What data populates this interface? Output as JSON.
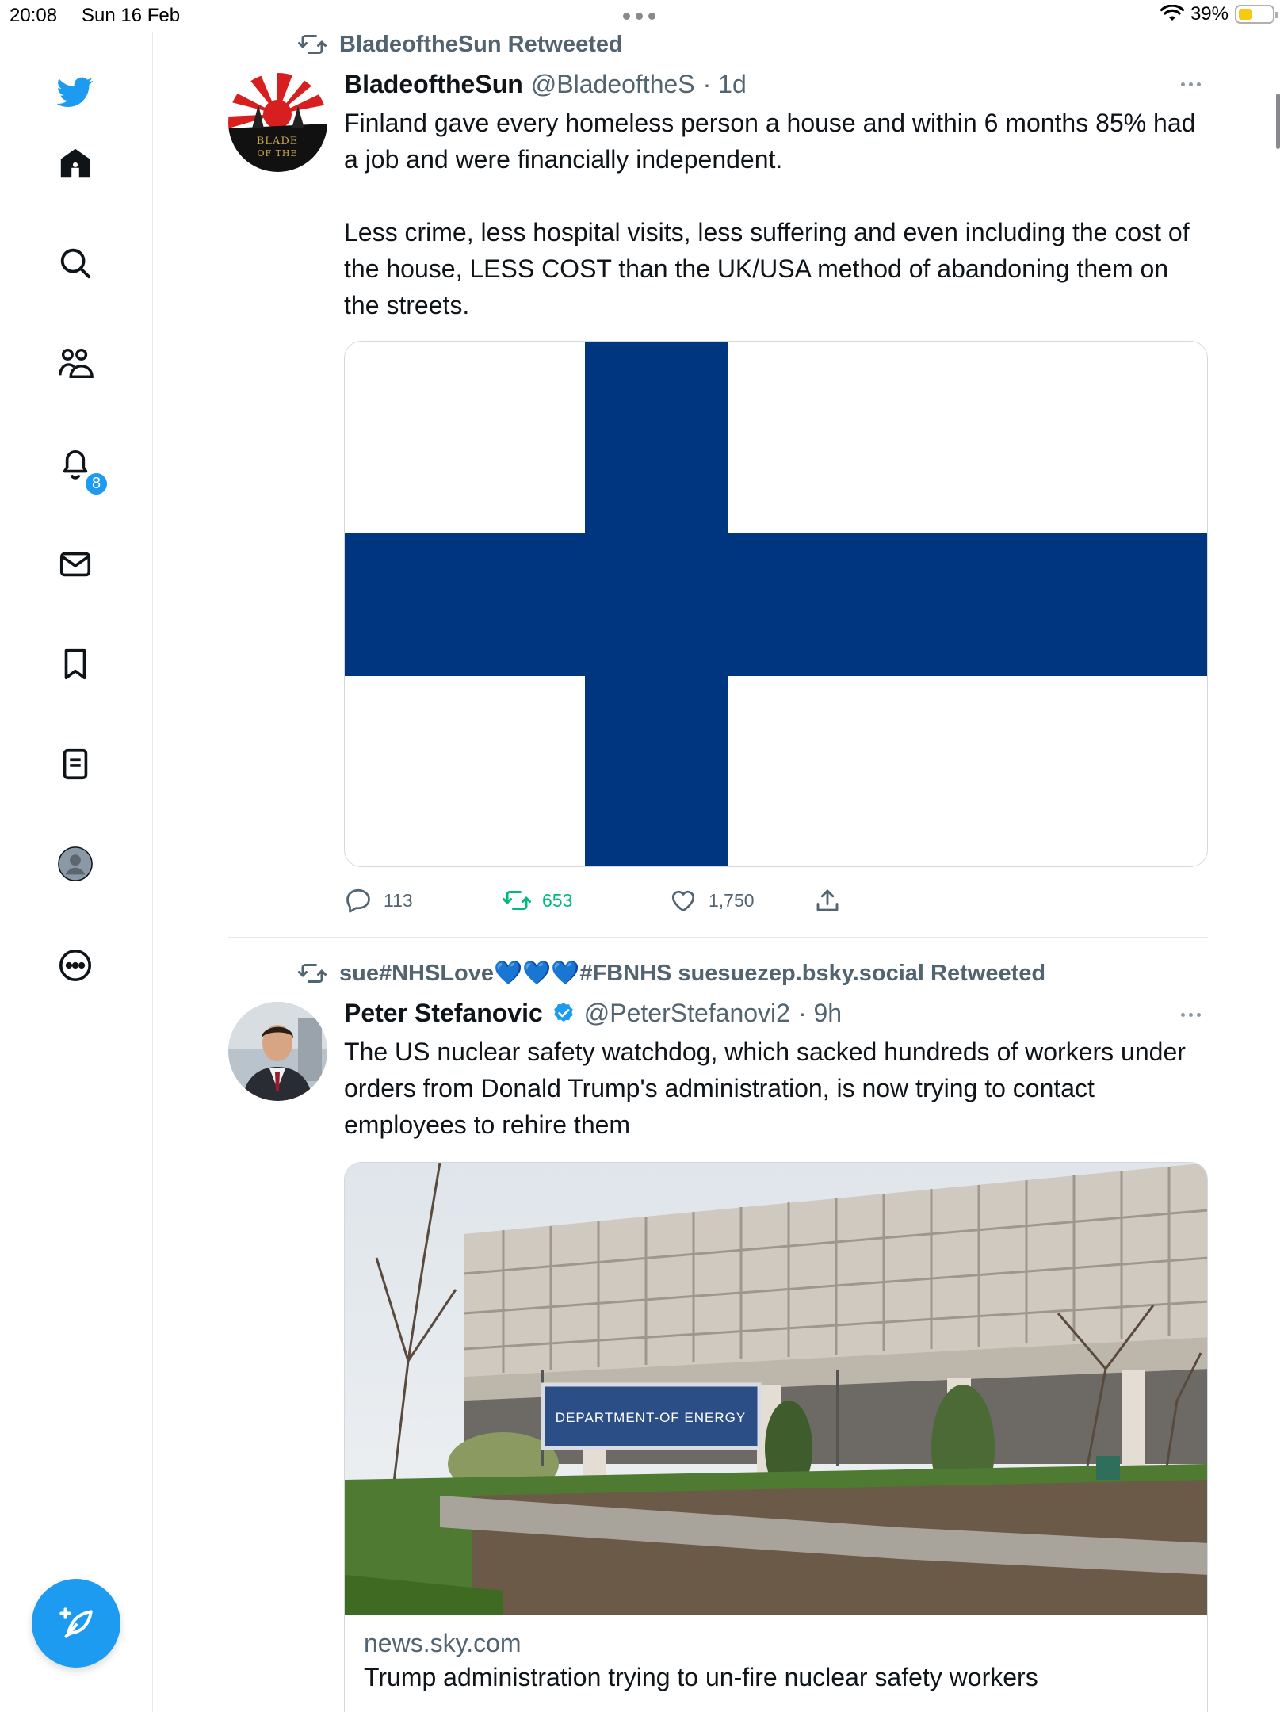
{
  "status_bar": {
    "time": "20:08",
    "date": "Sun 16 Feb",
    "battery": "39%",
    "battery_level": 0.39
  },
  "sidebar": {
    "logo": "twitter-bird-icon",
    "items": [
      {
        "icon": "home-icon"
      },
      {
        "icon": "search-icon"
      },
      {
        "icon": "communities-icon"
      },
      {
        "icon": "notifications-icon",
        "badge": "8"
      },
      {
        "icon": "messages-icon"
      },
      {
        "icon": "bookmarks-icon"
      },
      {
        "icon": "lists-icon"
      },
      {
        "icon": "profile-icon"
      },
      {
        "icon": "more-icon"
      }
    ],
    "compose_icon": "compose-feather-icon"
  },
  "colors": {
    "accent": "#1d9bf0",
    "retweet_green": "#00ba7c",
    "finland_blue": "#003580"
  },
  "timeline": [
    {
      "retweeted_by": "BladeoftheSun Retweeted",
      "name": "BladeoftheSun",
      "handle": "@BladeoftheS",
      "time": "· 1d",
      "text_1": "Finland gave every homeless person a house and within 6 months 85% had a job and were financially independent.",
      "text_2": "Less crime, less hospital visits, less suffering and even including the cost of the house, LESS COST than the UK/USA method of abandoning them on the streets.",
      "avatar_text": "BLADE OF THE",
      "stats": {
        "replies": "113",
        "retweets": "653",
        "likes": "1,750"
      }
    },
    {
      "retweeted_by": "sue#NHSLove💙💙💙#FBNHS suesuezep.bsky.social Retweeted",
      "name": "Peter Stefanovic",
      "handle": "@PeterStefanovi2",
      "time": "· 9h",
      "text": "The US nuclear safety watchdog, which sacked hundreds of workers under orders from Donald Trump's administration, is now trying to contact employees to rehire them",
      "image_sign": "DEPARTMENT-OF ENERGY",
      "card_domain": "news.sky.com",
      "card_title": "Trump administration trying to un-fire nuclear safety workers"
    }
  ]
}
